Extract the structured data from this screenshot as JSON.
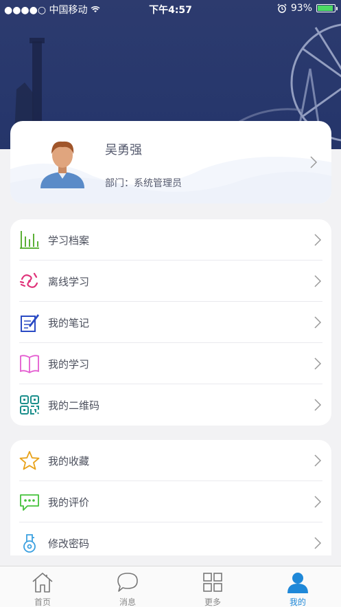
{
  "status_bar": {
    "carrier": "●●●●○ 中国移动",
    "time": "下午4:57",
    "battery": "93%"
  },
  "profile": {
    "name": "吴勇强",
    "department": "部门：系统管理员"
  },
  "menu_group_1": [
    {
      "label": "学习档案",
      "icon": "archive-chart-icon",
      "color": "#4aa81f"
    },
    {
      "label": "离线学习",
      "icon": "offline-icon",
      "color": "#e0337a"
    },
    {
      "label": "我的笔记",
      "icon": "note-icon",
      "color": "#2a4ac4"
    },
    {
      "label": "我的学习",
      "icon": "book-icon",
      "color": "#e45bd0"
    },
    {
      "label": "我的二维码",
      "icon": "qrcode-icon",
      "color": "#1b8f8c"
    }
  ],
  "menu_group_2": [
    {
      "label": "我的收藏",
      "icon": "star-icon",
      "color": "#e8a21a"
    },
    {
      "label": "我的评价",
      "icon": "comment-icon",
      "color": "#44c23a"
    },
    {
      "label": "修改密码",
      "icon": "key-icon",
      "color": "#3aa0e0"
    }
  ],
  "tabbar": [
    {
      "label": "首页",
      "icon": "home-icon"
    },
    {
      "label": "消息",
      "icon": "message-icon"
    },
    {
      "label": "更多",
      "icon": "grid-icon"
    },
    {
      "label": "我的",
      "icon": "person-icon",
      "active": true
    }
  ],
  "colors": {
    "hero": "#28386d",
    "tab_active": "#1f88d8",
    "background": "#f2f2f4"
  }
}
